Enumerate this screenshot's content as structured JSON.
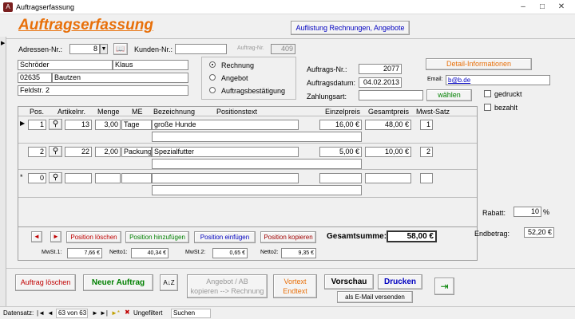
{
  "window": {
    "title": "Auftragserfassung",
    "app_icon": "access-app-icon",
    "btn_min": "–",
    "btn_max": "□",
    "btn_close": "✕"
  },
  "header": {
    "title": "Auftragserfassung",
    "listing_button": "Auflistung Rechnungen, Angebote"
  },
  "customer": {
    "adressen_label": "Adressen-Nr.:",
    "adressen_value": "8",
    "kunden_label": "Kunden-Nr.:",
    "kunden_value": "",
    "auftrag_nr_label": "Auftrag-Nr.",
    "auftrag_nr_value": "409",
    "last_name": "Schröder",
    "first_name": "Klaus",
    "zip": "02635",
    "city": "Bautzen",
    "street": "Feldstr. 2"
  },
  "doc_type": {
    "options": [
      "Rechnung",
      "Angebot",
      "Auftragsbestätigung"
    ],
    "selected": "Rechnung"
  },
  "order": {
    "auftragsnr_label": "Auftrags-Nr.:",
    "auftragsnr_value": "2077",
    "datum_label": "Auftragsdatum:",
    "datum_value": "04.02.2013",
    "zahlungsart_label": "Zahlungsart:",
    "zahlungsart_value": "",
    "waehlen_label": "wählen",
    "detail_label": "Detail-Informationen",
    "email_label": "Email:",
    "email_value": "b@b.de",
    "gedruckt_label": "gedruckt",
    "bezahlt_label": "bezahlt"
  },
  "positions": {
    "headers": {
      "pos": "Pos.",
      "artikel": "Artikelnr.",
      "menge": "Menge",
      "me": "ME",
      "bezeichnung": "Bezeichnung",
      "positionstext": "Positionstext",
      "einzelpreis": "Einzelpreis",
      "gesamtpreis": "Gesamtpreis",
      "mwst": "Mwst-Satz"
    },
    "rows": [
      {
        "marker": "▶",
        "pos": "1",
        "artikel": "13",
        "menge": "3,00",
        "me": "Tage",
        "bezeichnung": "große Hunde",
        "einzelpreis": "16,00 €",
        "gesamtpreis": "48,00 €",
        "mwst": "1"
      },
      {
        "marker": "",
        "pos": "2",
        "artikel": "22",
        "menge": "2,00",
        "me": "Packung",
        "bezeichnung": "Spezialfutter",
        "einzelpreis": "5,00 €",
        "gesamtpreis": "10,00 €",
        "mwst": "2"
      },
      {
        "marker": "*",
        "pos": "0",
        "artikel": "",
        "menge": "",
        "me": "",
        "bezeichnung": "",
        "einzelpreis": "",
        "gesamtpreis": "",
        "mwst": ""
      }
    ]
  },
  "totals": {
    "rabatt_label": "Rabatt:",
    "rabatt_value": "10",
    "rabatt_unit": "%",
    "endbetrag_label": "Endbetrag:",
    "endbetrag_value": "52,20 €",
    "gesamt_label": "Gesamtsumme:",
    "gesamt_value": "58,00 €",
    "mwst1_label": "MwSt.1:",
    "mwst1_value": "7,66 €",
    "netto1_label": "Netto1:",
    "netto1_value": "40,34 €",
    "mwst2_label": "MwSt.2:",
    "mwst2_value": "0,65 €",
    "netto2_label": "Netto2:",
    "netto2_value": "9,35 €"
  },
  "pos_buttons": {
    "prev": "◄",
    "next": "►",
    "loeschen": "Position löschen",
    "hinzu": "Position hinzufügen",
    "einfuegen": "Position einfügen",
    "kopieren": "Position kopieren"
  },
  "bottom": {
    "loeschen": "Auftrag löschen",
    "neu": "Neuer Auftrag",
    "sort": "A↓Z",
    "kopieren_line1": "Angebot / AB",
    "kopieren_line2": "kopieren --> Rechnung",
    "vortext_line1": "Vortext",
    "vortext_line2": "Endtext",
    "vorschau": "Vorschau",
    "drucken": "Drucken",
    "email": "als E-Mail versenden",
    "exit": "⇥"
  },
  "status": {
    "label": "Datensatz:",
    "first": "|◄",
    "prev": "◄",
    "record": "63 von 63",
    "next": "►",
    "last": "►|",
    "new": "►*",
    "filter": "Ungefiltert",
    "search": "Suchen"
  },
  "colors": {
    "title": "#e8700a",
    "red": "#c00000",
    "green": "#008000",
    "blue": "#0000c0",
    "darkred": "#a00000"
  }
}
